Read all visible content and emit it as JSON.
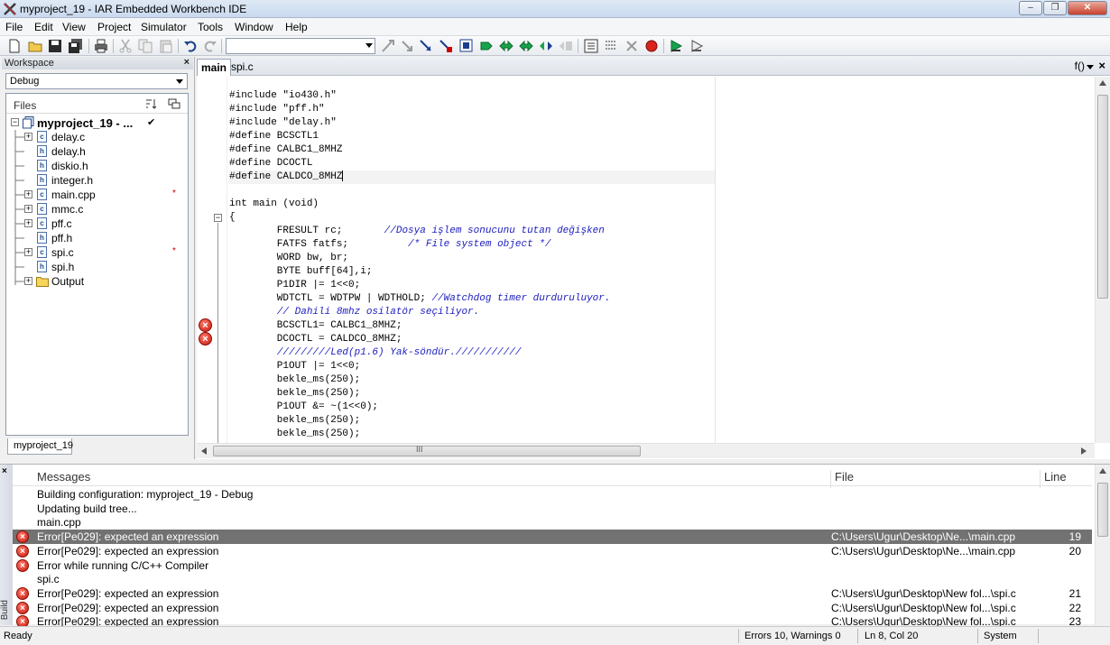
{
  "window": {
    "title": "myproject_19 - IAR Embedded Workbench IDE",
    "minimize": "–",
    "restore": "❐",
    "close": "✕"
  },
  "menu": [
    "File",
    "Edit",
    "View",
    "Project",
    "Simulator",
    "Tools",
    "Window",
    "Help"
  ],
  "toolbar": {
    "combo_value": "",
    "icons": [
      "new-file-icon",
      "open-icon",
      "save-icon",
      "save-all-icon",
      "print-icon",
      "cut-icon",
      "copy-icon",
      "paste-icon",
      "undo-icon",
      "redo-icon",
      "find-icon",
      "bookmark-icon",
      "next-bookmark-icon",
      "goto-icon",
      "compile-icon",
      "make-icon",
      "rebuild-icon",
      "stop-build-icon",
      "debug-icon",
      "breakpoint-icon",
      "download-icon",
      "run-icon"
    ]
  },
  "workspace": {
    "title": "Workspace",
    "close": "×",
    "config": "Debug",
    "files_header": "Files",
    "tab": "myproject_19",
    "project": "myproject_19 - ...",
    "check": "✔",
    "files": [
      {
        "name": "delay.c",
        "type": "c",
        "expand": "+",
        "modified": false
      },
      {
        "name": "delay.h",
        "type": "h",
        "expand": "",
        "modified": false
      },
      {
        "name": "diskio.h",
        "type": "h",
        "expand": "",
        "modified": false
      },
      {
        "name": "integer.h",
        "type": "h",
        "expand": "",
        "modified": false
      },
      {
        "name": "main.cpp",
        "type": "c",
        "expand": "+",
        "modified": true
      },
      {
        "name": "mmc.c",
        "type": "c",
        "expand": "+",
        "modified": false
      },
      {
        "name": "pff.c",
        "type": "c",
        "expand": "+",
        "modified": false
      },
      {
        "name": "pff.h",
        "type": "h",
        "expand": "",
        "modified": false
      },
      {
        "name": "spi.c",
        "type": "c",
        "expand": "+",
        "modified": true
      },
      {
        "name": "spi.h",
        "type": "h",
        "expand": "",
        "modified": false
      },
      {
        "name": "Output",
        "type": "folder",
        "expand": "+",
        "modified": false
      }
    ],
    "modified_mark": "*"
  },
  "editor": {
    "tabs": [
      "main",
      "spi.c"
    ],
    "active_tab": "main",
    "function": "f()",
    "close": "×",
    "lines": [
      {
        "code": "#include \"io430.h\"",
        "comment": ""
      },
      {
        "code": "#include \"pff.h\"",
        "comment": ""
      },
      {
        "code": "#include \"delay.h\"",
        "comment": ""
      },
      {
        "code": "#define BCSCTL1",
        "comment": ""
      },
      {
        "code": "#define CALBC1_8MHZ",
        "comment": ""
      },
      {
        "code": "#define DCOCTL",
        "comment": ""
      },
      {
        "code": "#define CALDCO_8MHZ",
        "comment": "",
        "highlight": true
      },
      {
        "code": "",
        "comment": ""
      },
      {
        "code": "int main (void)",
        "comment": ""
      },
      {
        "code": "{",
        "comment": ""
      },
      {
        "code": "        FRESULT rc;       ",
        "comment": "//Dosya işlem sonucunu tutan değişken"
      },
      {
        "code": "        FATFS fatfs;          ",
        "comment": "/* File system object */"
      },
      {
        "code": "        WORD bw, br;",
        "comment": ""
      },
      {
        "code": "        BYTE buff[64],i;",
        "comment": ""
      },
      {
        "code": "        P1DIR |= 1<<0;",
        "comment": ""
      },
      {
        "code": "        WDTCTL = WDTPW | WDTHOLD; ",
        "comment": "//Watchdog timer durduruluyor."
      },
      {
        "code": "        ",
        "comment": "// Dahili 8mhz osilatör seçiliyor."
      },
      {
        "code": "        BCSCTL1= CALBC1_8MHZ;",
        "comment": "",
        "error": true
      },
      {
        "code": "        DCOCTL = CALDCO_8MHZ;",
        "comment": "",
        "error": true
      },
      {
        "code": "        ",
        "comment": "/////////Led(p1.6) Yak-söndür.///////////"
      },
      {
        "code": "        P1OUT |= 1<<0;",
        "comment": ""
      },
      {
        "code": "        bekle_ms(250);",
        "comment": ""
      },
      {
        "code": "        bekle_ms(250);",
        "comment": ""
      },
      {
        "code": "        P1OUT &= ~(1<<0);",
        "comment": ""
      },
      {
        "code": "        bekle_ms(250);",
        "comment": ""
      },
      {
        "code": "        bekle_ms(250);",
        "comment": ""
      }
    ],
    "fold_mark": "−",
    "hscroll_grip": "III"
  },
  "messages": {
    "side_close": "×",
    "side_label": "Build",
    "headers": {
      "messages": "Messages",
      "file": "File",
      "line": "Line"
    },
    "rows": [
      {
        "text": "Building configuration: myproject_19 - Debug",
        "file": "",
        "line": "",
        "error": false,
        "selected": false
      },
      {
        "text": "Updating build tree...",
        "file": "",
        "line": "",
        "error": false,
        "selected": false
      },
      {
        "text": "main.cpp",
        "file": "",
        "line": "",
        "error": false,
        "selected": false
      },
      {
        "text": "Error[Pe029]: expected an expression",
        "file": "C:\\Users\\Ugur\\Desktop\\Ne...\\main.cpp",
        "line": "19",
        "error": true,
        "selected": true
      },
      {
        "text": "Error[Pe029]: expected an expression",
        "file": "C:\\Users\\Ugur\\Desktop\\Ne...\\main.cpp",
        "line": "20",
        "error": true,
        "selected": false
      },
      {
        "text": "Error while running C/C++ Compiler",
        "file": "",
        "line": "",
        "error": true,
        "selected": false
      },
      {
        "text": "spi.c",
        "file": "",
        "line": "",
        "error": false,
        "selected": false
      },
      {
        "text": "Error[Pe029]: expected an expression",
        "file": "C:\\Users\\Ugur\\Desktop\\New fol...\\spi.c",
        "line": "21",
        "error": true,
        "selected": false
      },
      {
        "text": "Error[Pe029]: expected an expression",
        "file": "C:\\Users\\Ugur\\Desktop\\New fol...\\spi.c",
        "line": "22",
        "error": true,
        "selected": false
      },
      {
        "text": "Error[Pe029]: expected an expression",
        "file": "C:\\Users\\Ugur\\Desktop\\New fol...\\spi.c",
        "line": "23",
        "error": true,
        "selected": false
      }
    ]
  },
  "status": {
    "ready": "Ready",
    "errors": "Errors 10, Warnings 0",
    "position": "Ln 8, Col 20",
    "mode": "System"
  },
  "colors": {
    "comment": "#2020c0",
    "error": "#c4160a",
    "selection": "#727272"
  }
}
